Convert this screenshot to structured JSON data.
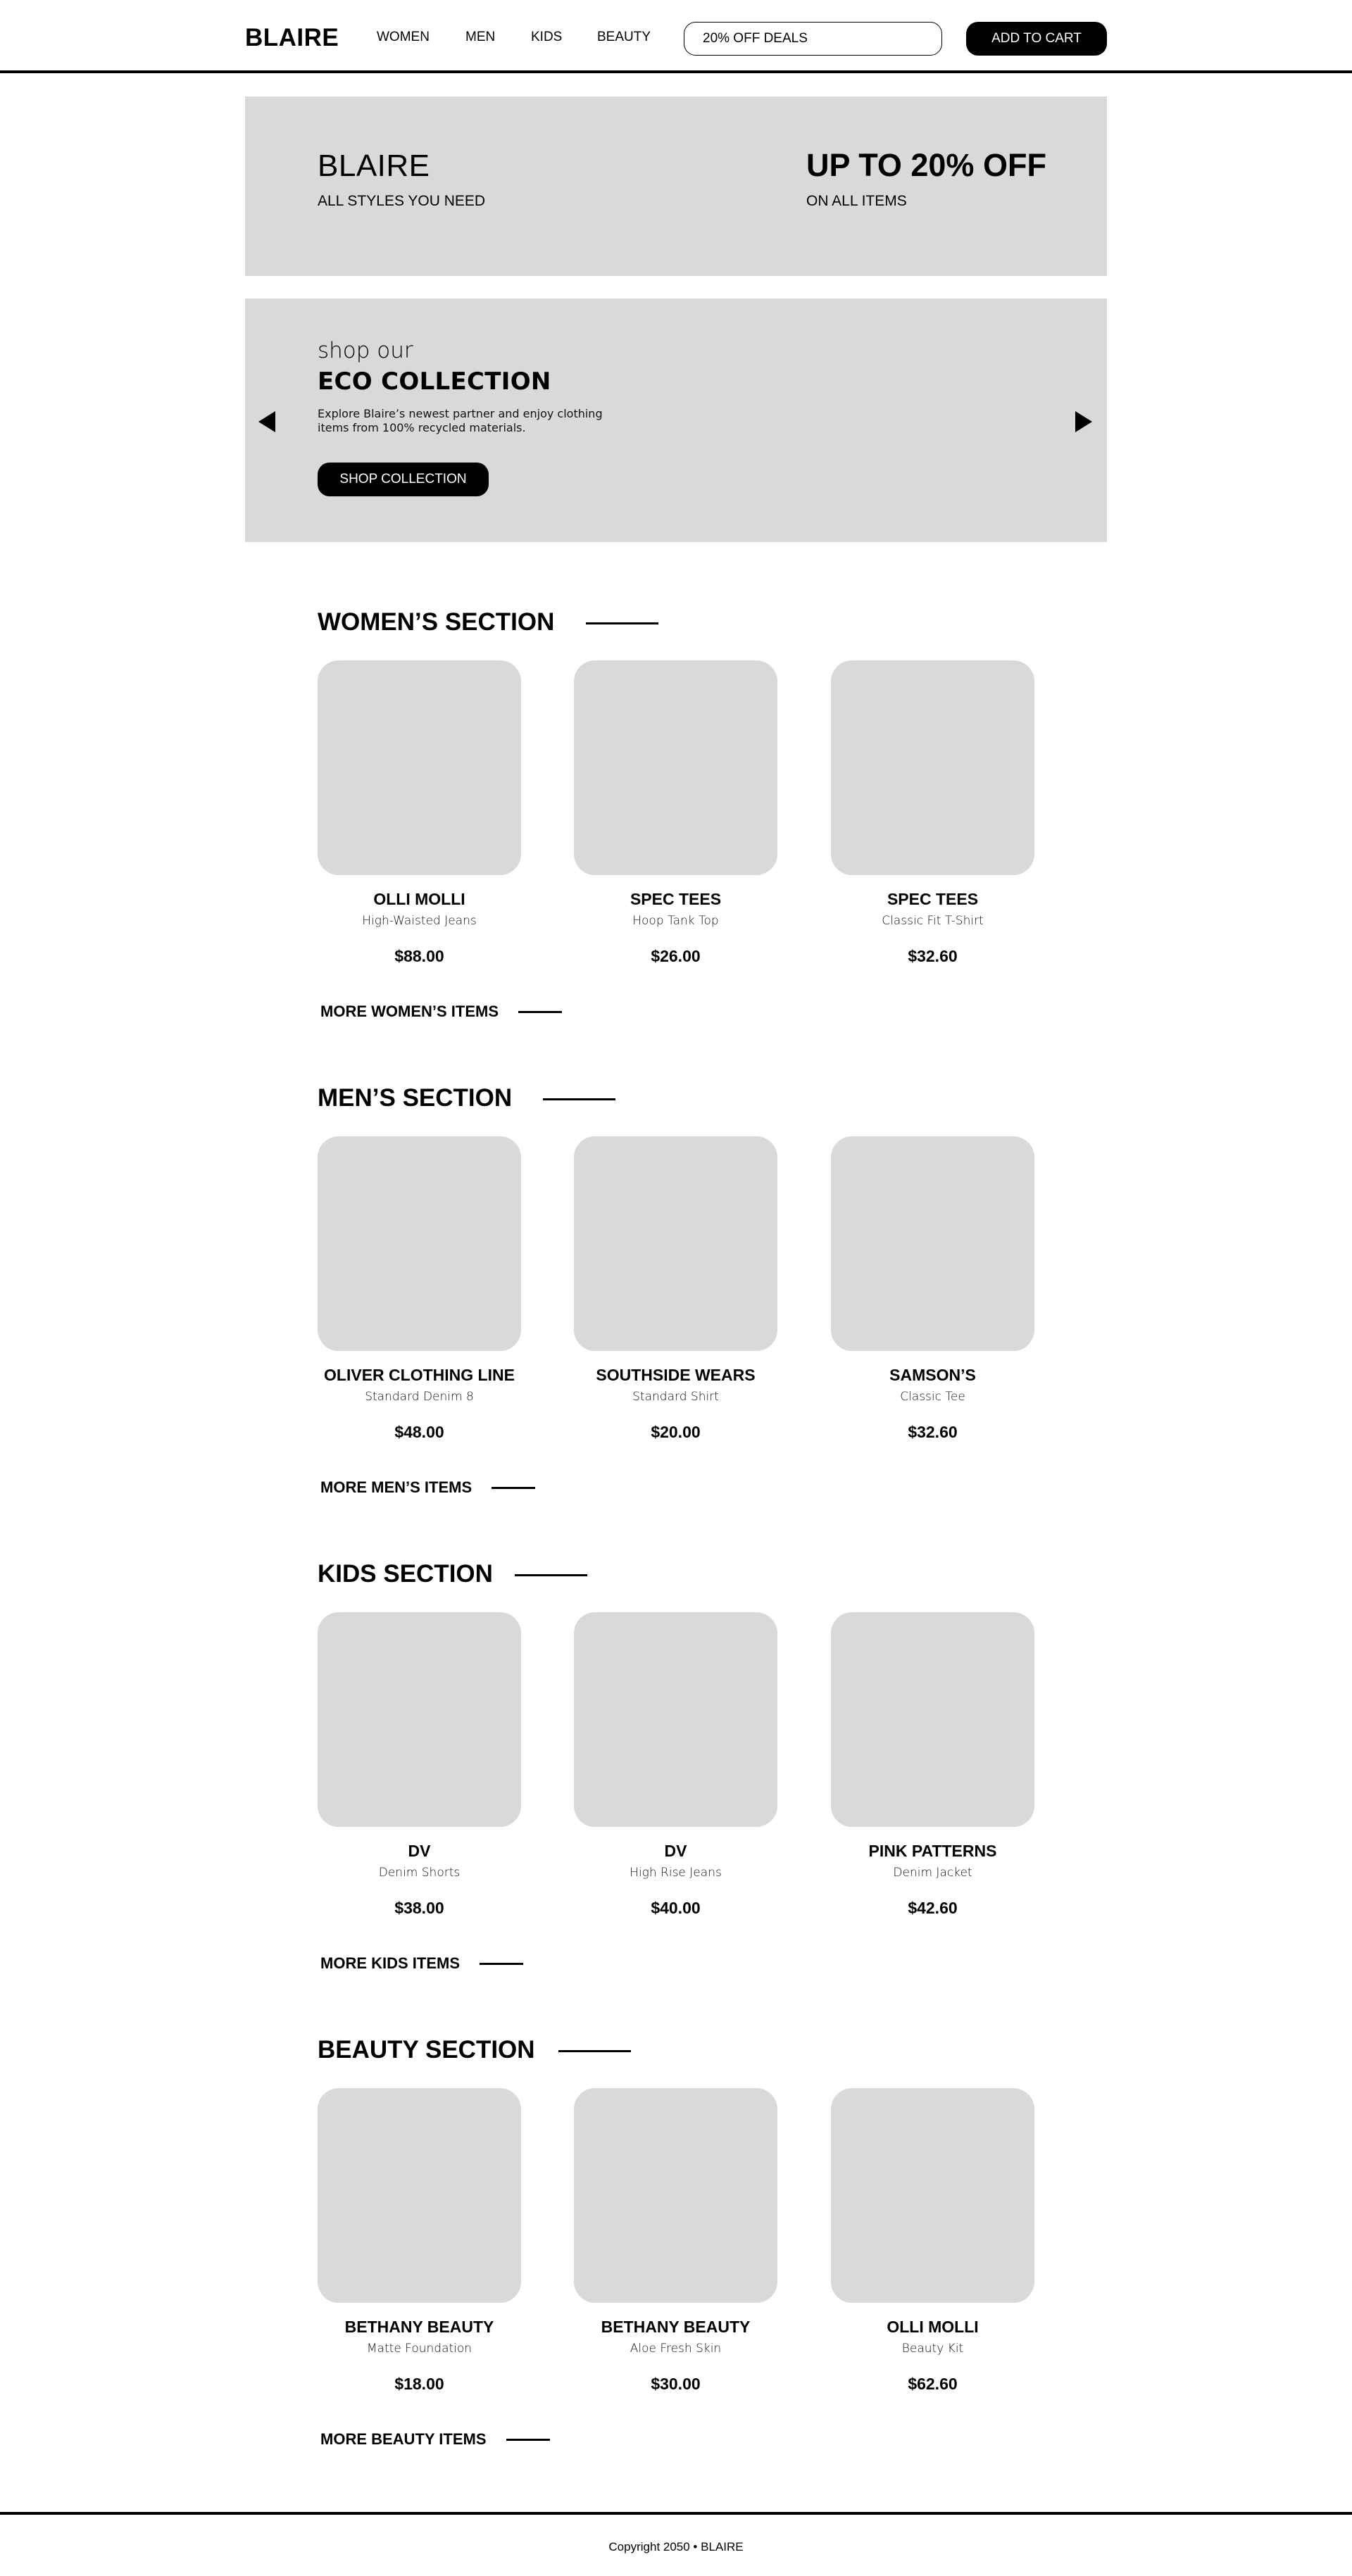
{
  "header": {
    "logo": "BLAIRE",
    "nav": [
      {
        "label": "WOMEN"
      },
      {
        "label": "MEN"
      },
      {
        "label": "KIDS"
      },
      {
        "label": "BEAUTY"
      }
    ],
    "deals_field_value": "20% OFF DEALS",
    "cart_button": "ADD TO CART"
  },
  "promo": {
    "brand": "BLAIRE",
    "tagline": "ALL STYLES YOU NEED",
    "offer": "UP TO 20% OFF",
    "offer_sub": "ON ALL ITEMS"
  },
  "eco": {
    "kicker": "shop our",
    "title": "ECO COLLECTION",
    "description": "Explore Blaire’s newest partner and enjoy clothing items from 100% recycled materials.",
    "button": "SHOP COLLECTION",
    "prev_icon": "triangle-left",
    "next_icon": "triangle-right"
  },
  "sections": [
    {
      "title": "WOMEN’S SECTION",
      "more": "MORE WOMEN’S ITEMS",
      "products": [
        {
          "brand": "OLLI MOLLI",
          "name": "High-Waisted Jeans",
          "price": "$88.00"
        },
        {
          "brand": "SPEC TEES",
          "name": "Hoop Tank Top",
          "price": "$26.00"
        },
        {
          "brand": "SPEC TEES",
          "name": "Classic Fit T-Shirt",
          "price": "$32.60"
        }
      ]
    },
    {
      "title": "MEN’S SECTION",
      "more": "MORE MEN’S ITEMS",
      "products": [
        {
          "brand": "OLIVER CLOTHING LINE",
          "name": "Standard Denim 8",
          "price": "$48.00"
        },
        {
          "brand": "SOUTHSIDE WEARS",
          "name": "Standard Shirt",
          "price": "$20.00"
        },
        {
          "brand": "SAMSON’S",
          "name": "Classic Tee",
          "price": "$32.60"
        }
      ]
    },
    {
      "title": "KIDS SECTION",
      "more": "MORE KIDS ITEMS",
      "products": [
        {
          "brand": "DV",
          "name": "Denim Shorts",
          "price": "$38.00"
        },
        {
          "brand": "DV",
          "name": "High Rise Jeans",
          "price": "$40.00"
        },
        {
          "brand": "PINK PATTERNS",
          "name": "Denim Jacket",
          "price": "$42.60"
        }
      ]
    },
    {
      "title": "BEAUTY SECTION",
      "more": "MORE BEAUTY ITEMS",
      "products": [
        {
          "brand": "BETHANY BEAUTY",
          "name": "Matte Foundation",
          "price": "$18.00"
        },
        {
          "brand": "BETHANY BEAUTY",
          "name": "Aloe Fresh Skin",
          "price": "$30.00"
        },
        {
          "brand": "OLLI MOLLI",
          "name": "Beauty Kit",
          "price": "$62.60"
        }
      ]
    }
  ],
  "footer": {
    "copyright": "Copyright 2050 • BLAIRE"
  },
  "colors": {
    "placeholder_gray": "#d9d9d9",
    "primary": "#000000",
    "background": "#ffffff"
  }
}
